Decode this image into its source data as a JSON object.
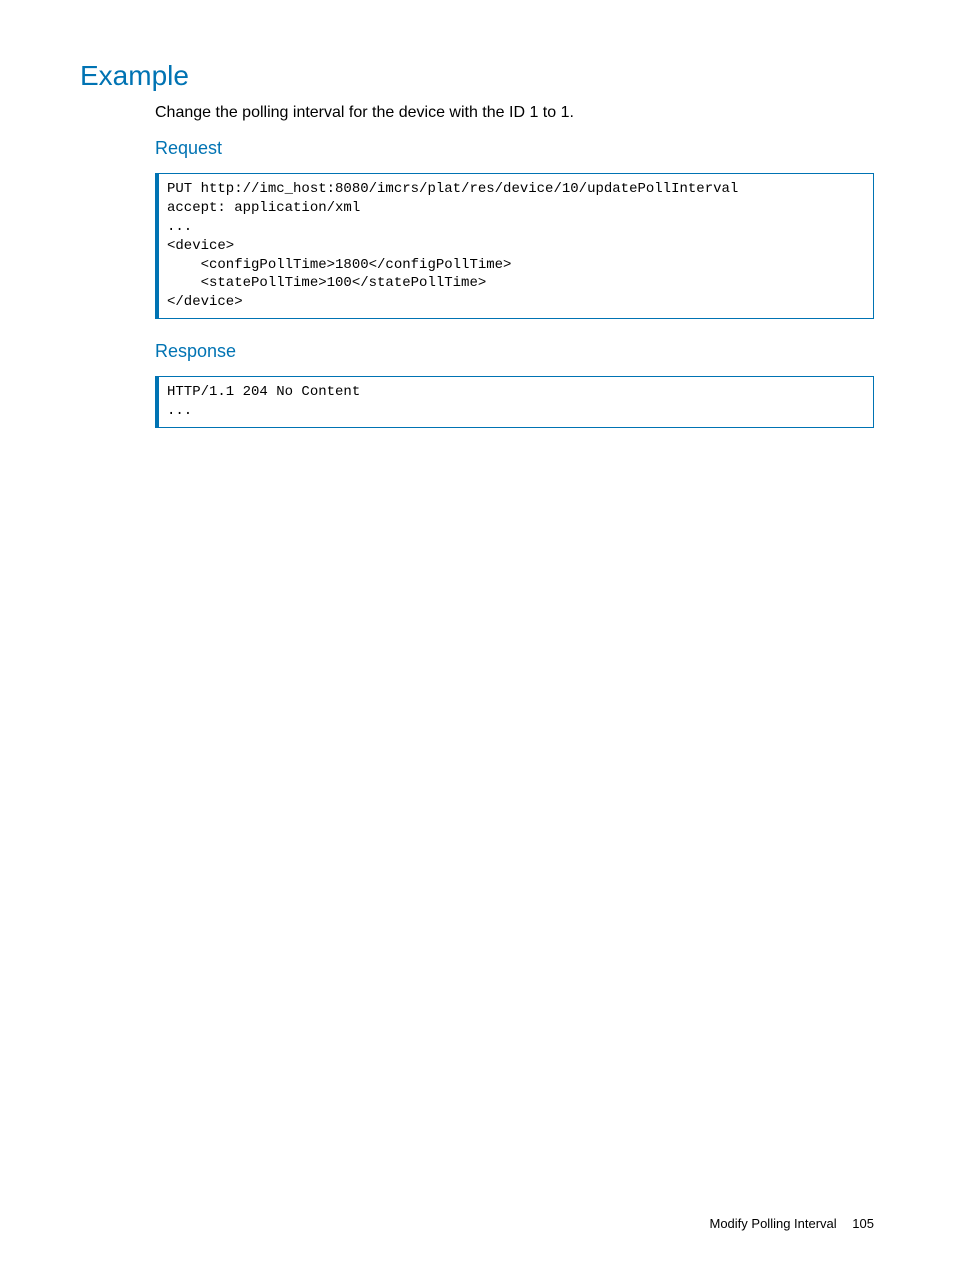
{
  "heading": "Example",
  "intro": "Change the polling interval for the device with the ID 1 to 1.",
  "request": {
    "heading": "Request",
    "code": "PUT http://imc_host:8080/imcrs/plat/res/device/10/updatePollInterval\naccept: application/xml\n...\n<device>\n    <configPollTime>1800</configPollTime>\n    <statePollTime>100</statePollTime>\n</device>"
  },
  "response": {
    "heading": "Response",
    "code": "HTTP/1.1 204 No Content\n..."
  },
  "footer": {
    "title": "Modify Polling Interval",
    "page": "105"
  }
}
